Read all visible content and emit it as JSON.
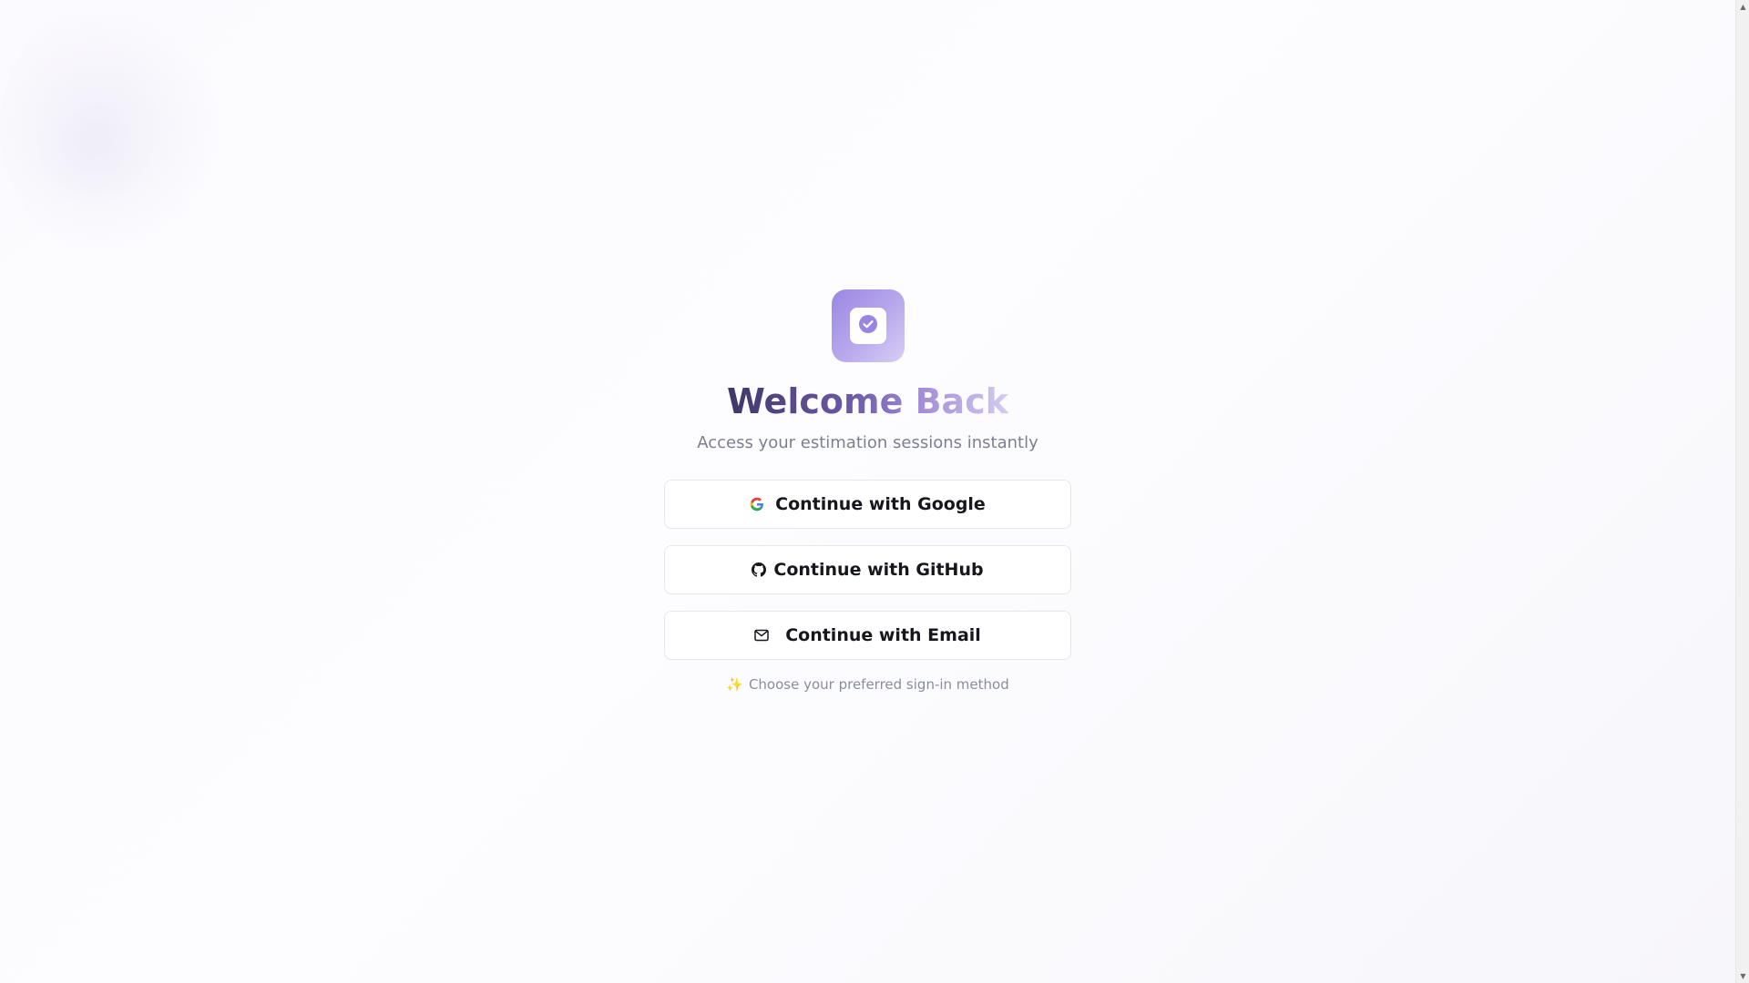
{
  "welcome": {
    "title": "Welcome Back",
    "subtitle": "Access your estimation sessions instantly"
  },
  "auth": {
    "google_label": "Continue with Google",
    "github_label": "Continue with GitHub",
    "email_label": "Continue with Email",
    "hint": "Choose your preferred sign-in method",
    "hint_glyph": "✨"
  },
  "icons": {
    "logo": "check-badge-icon",
    "google": "google-icon",
    "github": "github-icon",
    "email": "mail-icon",
    "hint": "sparkles-icon"
  },
  "colors": {
    "accent": "#9b86e4",
    "title_dark": "#3f3669",
    "title_light": "#d5cbf0",
    "subtitle": "#7c7f8f",
    "button_border": "#e6e6ec",
    "button_text": "#16161d"
  }
}
